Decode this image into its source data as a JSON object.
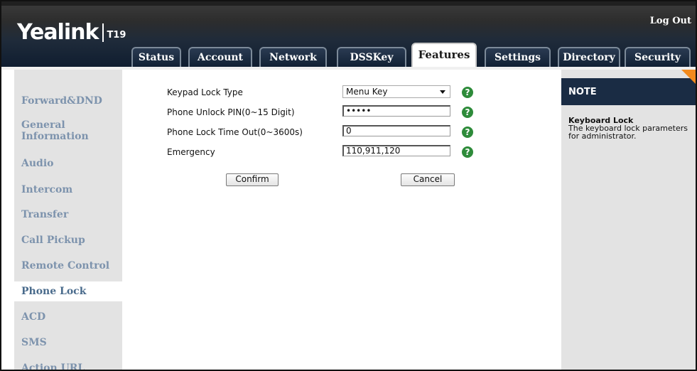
{
  "header": {
    "logo_text": "Yealink",
    "model": "T19",
    "logout_label": "Log Out"
  },
  "tabs": [
    {
      "label": "Status"
    },
    {
      "label": "Account"
    },
    {
      "label": "Network"
    },
    {
      "label": "DSSKey"
    },
    {
      "label": "Features",
      "active": true
    },
    {
      "label": "Settings"
    },
    {
      "label": "Directory"
    },
    {
      "label": "Security"
    }
  ],
  "sidebar": {
    "items": [
      {
        "label": "Forward&DND"
      },
      {
        "label": "General Information"
      },
      {
        "label": "Audio"
      },
      {
        "label": "Intercom"
      },
      {
        "label": "Transfer"
      },
      {
        "label": "Call Pickup"
      },
      {
        "label": "Remote Control"
      },
      {
        "label": "Phone Lock",
        "active": true
      },
      {
        "label": "ACD"
      },
      {
        "label": "SMS"
      },
      {
        "label": "Action URL"
      }
    ]
  },
  "form": {
    "keypad_lock_type": {
      "label": "Keypad Lock Type",
      "value": "Menu Key"
    },
    "unlock_pin": {
      "label": "Phone Unlock PIN(0~15 Digit)",
      "value": "•••••"
    },
    "lock_timeout": {
      "label": "Phone Lock Time Out(0~3600s)",
      "value": "0"
    },
    "emergency": {
      "label": "Emergency",
      "value": "110,911,120"
    },
    "help_glyph": "?",
    "confirm_label": "Confirm",
    "cancel_label": "Cancel"
  },
  "note": {
    "title": "NOTE",
    "heading": "Keyboard Lock",
    "text": "The keyboard lock parameters for administrator."
  },
  "colors": {
    "header_dark": "#1a2c44",
    "accent_orange": "#f28a1d",
    "help_green": "#2e8b3a",
    "sidebar_link": "#7d93ad"
  }
}
